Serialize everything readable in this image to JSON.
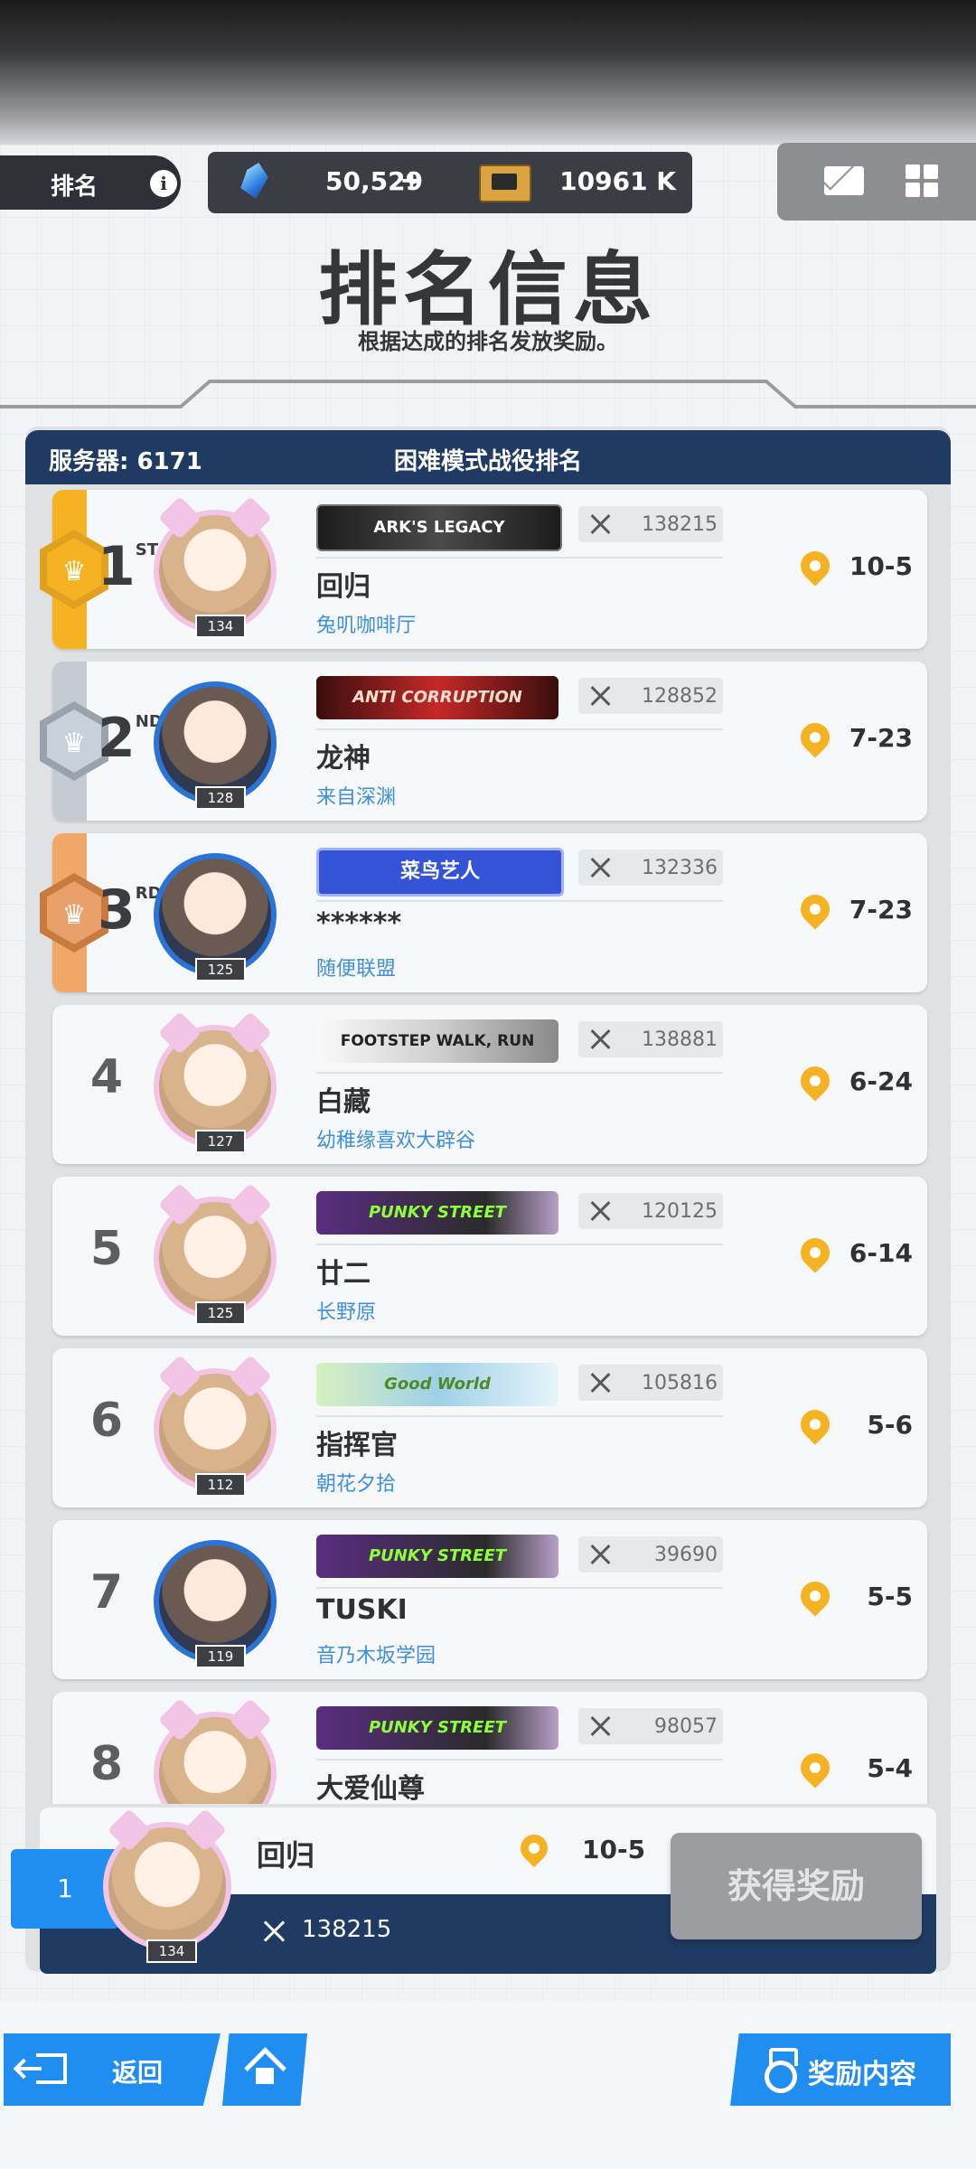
{
  "topbar": {
    "tab_label": "排名",
    "info_glyph": "i",
    "gem_value": "50,529",
    "gem_plus": "+",
    "ticket_value": "10961 K",
    "icons": [
      "crystal-gem-icon",
      "ticket-icon",
      "mail-icon",
      "grid-menu-icon"
    ]
  },
  "header": {
    "title": "排名信息",
    "subtitle": "根据达成的排名发放奖励。"
  },
  "panel": {
    "server": "服务器: 6171",
    "mode": "困难模式战役排名"
  },
  "colors": {
    "gold": "#f5b323",
    "silver": "#b4bcc6",
    "bronze": "#f0a767",
    "navy": "#1f3a63",
    "accent_blue": "#1f8ef0",
    "guild_blue": "#3d8fe0"
  },
  "rows": [
    {
      "rank": "1",
      "suffix": "ST",
      "level": "134",
      "banner": "ARK'S LEGACY",
      "score": "138215",
      "name": "回归",
      "guild": "兔叽咖啡厅",
      "stage": "10-5"
    },
    {
      "rank": "2",
      "suffix": "ND",
      "level": "128",
      "banner": "ANTI CORRUPTION",
      "score": "128852",
      "name": "龙神",
      "guild": "来自深渊",
      "stage": "7-23"
    },
    {
      "rank": "3",
      "suffix": "RD",
      "level": "125",
      "banner": "菜鸟艺人",
      "score": "132336",
      "name": "******",
      "guild": "随便联盟",
      "stage": "7-23"
    },
    {
      "rank": "4",
      "level": "127",
      "banner": "FOOTSTEP WALK, RUN",
      "score": "138881",
      "name": "白藏",
      "guild": "幼稚缘喜欢大辟谷",
      "stage": "6-24"
    },
    {
      "rank": "5",
      "level": "125",
      "banner": "PUNKY STREET",
      "score": "120125",
      "name": "廿二",
      "guild": "长野原",
      "stage": "6-14"
    },
    {
      "rank": "6",
      "level": "112",
      "banner": "Good World",
      "score": "105816",
      "name": "指挥官",
      "guild": "朝花夕拾",
      "stage": "5-6"
    },
    {
      "rank": "7",
      "level": "119",
      "banner": "PUNKY STREET",
      "score": "39690",
      "name": "TUSKI",
      "guild": "音乃木坂学园",
      "stage": "5-5"
    },
    {
      "rank": "8",
      "level": "",
      "banner": "PUNKY STREET",
      "score": "98057",
      "name": "大爱仙尊",
      "guild": "",
      "stage": "5-4"
    }
  ],
  "my_rank": {
    "rank": "1",
    "level": "134",
    "name": "回归",
    "stage": "10-5",
    "score": "138215",
    "claim_label": "获得奖励"
  },
  "bottom_nav": {
    "back_label": "返回",
    "reward_label": "奖励内容"
  }
}
